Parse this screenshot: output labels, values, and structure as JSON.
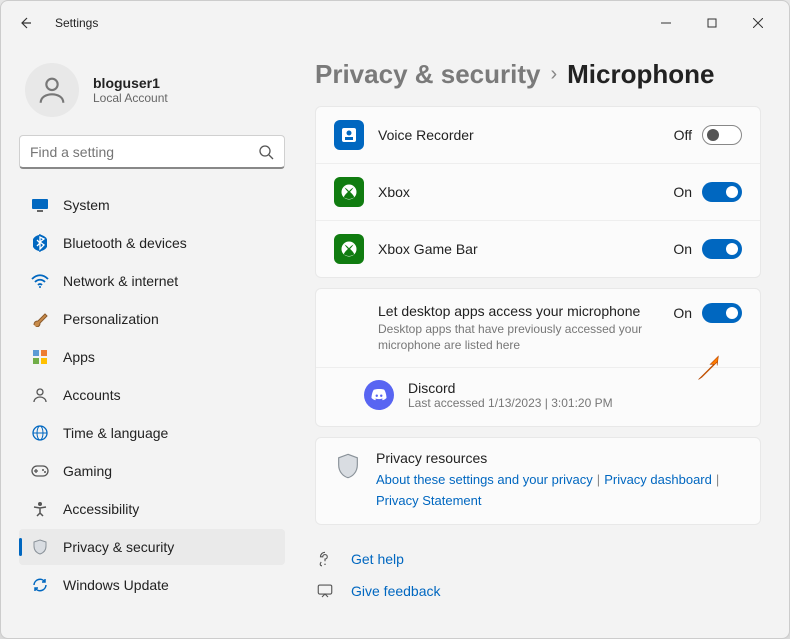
{
  "window": {
    "title": "Settings"
  },
  "user": {
    "name": "bloguser1",
    "account_type": "Local Account"
  },
  "search": {
    "placeholder": "Find a setting"
  },
  "sidebar": {
    "items": [
      {
        "label": "System",
        "icon": "system"
      },
      {
        "label": "Bluetooth & devices",
        "icon": "bluetooth"
      },
      {
        "label": "Network & internet",
        "icon": "wifi"
      },
      {
        "label": "Personalization",
        "icon": "brush"
      },
      {
        "label": "Apps",
        "icon": "apps"
      },
      {
        "label": "Accounts",
        "icon": "account"
      },
      {
        "label": "Time & language",
        "icon": "globe"
      },
      {
        "label": "Gaming",
        "icon": "game"
      },
      {
        "label": "Accessibility",
        "icon": "accessibility"
      },
      {
        "label": "Privacy & security",
        "icon": "shield",
        "selected": true
      },
      {
        "label": "Windows Update",
        "icon": "update"
      }
    ]
  },
  "breadcrumb": {
    "parent": "Privacy & security",
    "current": "Microphone"
  },
  "apps": [
    {
      "name": "Voice Recorder",
      "state": "Off",
      "icon_bg": "#0067c0"
    },
    {
      "name": "Xbox",
      "state": "On",
      "icon_bg": "#107c10"
    },
    {
      "name": "Xbox Game Bar",
      "state": "On",
      "icon_bg": "#107c10"
    }
  ],
  "desktop_apps": {
    "title": "Let desktop apps access your microphone",
    "subtitle": "Desktop apps that have previously accessed your microphone are listed here",
    "state": "On",
    "list": [
      {
        "name": "Discord",
        "last_accessed": "Last accessed 1/13/2023  |  3:01:20 PM"
      }
    ]
  },
  "resources": {
    "title": "Privacy resources",
    "links": [
      "About these settings and your privacy",
      "Privacy dashboard",
      "Privacy Statement"
    ]
  },
  "footer": {
    "help": "Get help",
    "feedback": "Give feedback"
  }
}
